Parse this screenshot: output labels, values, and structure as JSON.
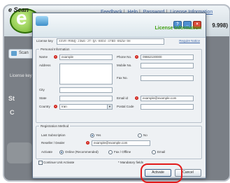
{
  "app": {
    "brand": "e Scan",
    "top_links": [
      "Feedback",
      "Help",
      "Password",
      "License Information"
    ],
    "side_number": "9.998)",
    "side_tab_label": "Scan",
    "left_license_text": "License key",
    "left_mid_text": "St",
    "left_c_text": "C"
  },
  "dialog": {
    "title": "License Information",
    "license_key_label": "License key",
    "license_key_value": "XXVR-M9NQ-J3W6-JT-QA-K0D4-47BD-KNZW-9H",
    "license_link": "Require Notice",
    "personal_section": "Personal Information",
    "fields": {
      "name_label": "Name",
      "name_value": "example",
      "address_label": "Address",
      "city_label": "City",
      "state_label": "State",
      "country_label": "Country",
      "country_value": "Iran",
      "phone_label": "Phone No.",
      "phone_value": "09862100000",
      "mobile_label": "Mobile No.",
      "fax_label": "Fax No.",
      "email_label": "Email id",
      "email_value": "example@example.com",
      "postal_label": "Postal Code"
    },
    "activation_section": "Registration Method",
    "last_subscription_label": "Last Subscription",
    "yes_label": "Yes",
    "no_label": "No",
    "reseller_label": "Reseller / Dealer",
    "reseller_value": "example@example.com",
    "activate_label": "Activate",
    "online_label": "Online (Recommended)",
    "fax_offline_label": "Fax / Offline",
    "email_option_label": "Email",
    "continue_label": "Continue Unit Activate",
    "required_note": "* Mandatory fields",
    "buttons": {
      "activate": "Activate",
      "cancel": "Cancel"
    }
  }
}
